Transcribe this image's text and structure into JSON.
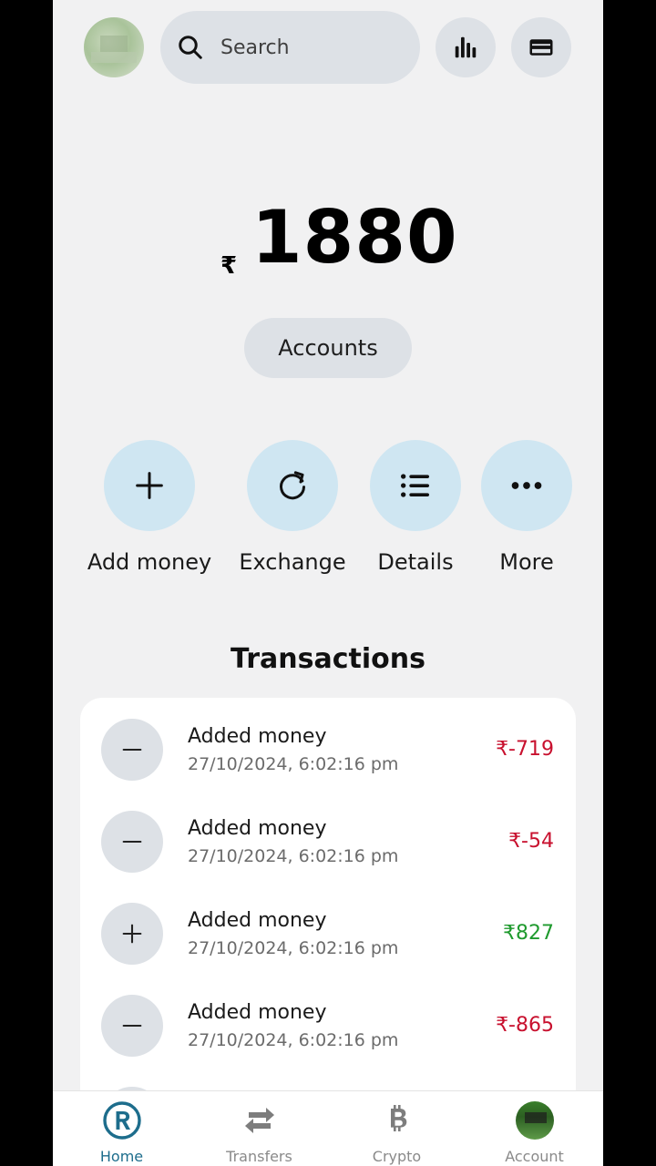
{
  "header": {
    "search_placeholder": "Search",
    "icons": {
      "search": "search-icon",
      "stats": "bar-chart-icon",
      "card": "card-icon"
    }
  },
  "balance": {
    "currency_symbol": "₹",
    "amount": "1880"
  },
  "accounts_button": "Accounts",
  "actions": [
    {
      "label": "Add money",
      "icon": "plus-icon"
    },
    {
      "label": "Exchange",
      "icon": "refresh-icon"
    },
    {
      "label": "Details",
      "icon": "list-icon"
    },
    {
      "label": "More",
      "icon": "more-dots-icon"
    }
  ],
  "transactions": {
    "title": "Transactions",
    "items": [
      {
        "name": "Added money",
        "date": "27/10/2024, 6:02:16 pm",
        "amount": "₹-719",
        "type": "minus"
      },
      {
        "name": "Added money",
        "date": "27/10/2024, 6:02:16 pm",
        "amount": "₹-54",
        "type": "minus"
      },
      {
        "name": "Added money",
        "date": "27/10/2024, 6:02:16 pm",
        "amount": "₹827",
        "type": "plus"
      },
      {
        "name": "Added money",
        "date": "27/10/2024, 6:02:16 pm",
        "amount": "₹-865",
        "type": "minus"
      }
    ]
  },
  "nav": {
    "items": [
      {
        "label": "Home",
        "active": true
      },
      {
        "label": "Transfers",
        "active": false
      },
      {
        "label": "Crypto",
        "active": false
      },
      {
        "label": "Account",
        "active": false
      }
    ]
  },
  "colors": {
    "negative": "#c8102e",
    "positive": "#1f9a2e",
    "accent": "#1d6d8c",
    "action_bg": "#cfe6f2"
  }
}
